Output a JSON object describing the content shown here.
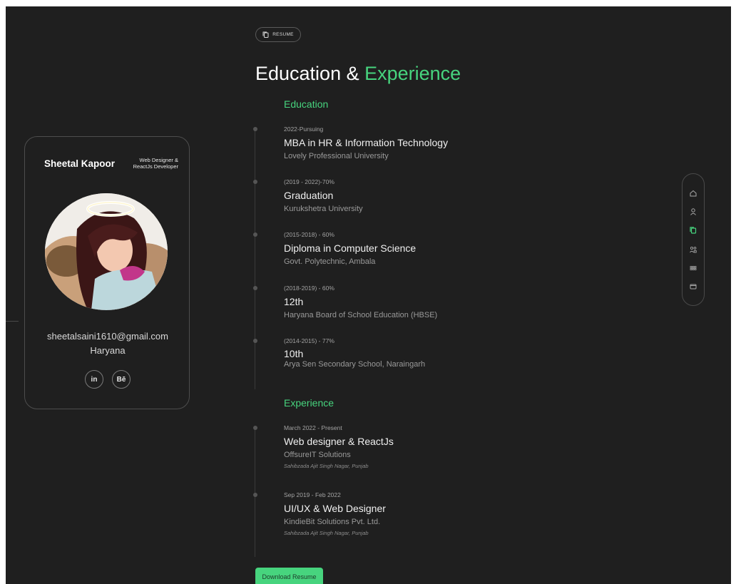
{
  "profile": {
    "name": "Sheetal Kapoor",
    "role_line1": "Web Designer &",
    "role_line2": "ReactJs Developer",
    "email": "sheetalsaini1610@gmail.com",
    "location": "Haryana",
    "social": [
      {
        "label": "in",
        "icon": "linkedin-icon"
      },
      {
        "label": "Bē",
        "icon": "behance-icon"
      }
    ]
  },
  "chip": {
    "label": "RESUME",
    "icon": "resume-icon"
  },
  "headline": {
    "part1": "Education & ",
    "accent": "Experience"
  },
  "education": {
    "title": "Education",
    "items": [
      {
        "period": "2022-Pursuing",
        "title": "MBA in HR & Information Technology",
        "place": "Lovely Professional University"
      },
      {
        "period": "(2019 - 2022)-70%",
        "title": "Graduation",
        "place": "Kurukshetra University"
      },
      {
        "period": "(2015-2018) - 60%",
        "title": "Diploma in Computer Science",
        "place": "Govt. Polytechnic, Ambala"
      },
      {
        "period": "(2018-2019) - 60%",
        "title": "12th",
        "place": "Haryana Board of School Education (HBSE)"
      },
      {
        "period": "(2014-2015) - 77%",
        "title": "10th",
        "place": "Arya Sen Secondary School, Naraingarh"
      }
    ]
  },
  "experience": {
    "title": "Experience",
    "items": [
      {
        "period": "March 2022 - Present",
        "title": "Web designer & ReactJs",
        "place": "OffsureIT Solutions",
        "location": "Sahibzada Ajit Singh Nagar, Punjab"
      },
      {
        "period": "Sep 2019 - Feb 2022",
        "title": "UI/UX & Web Designer",
        "place": "KindieBit Solutions Pvt. Ltd.",
        "location": "Sahibzada Ajit Singh Nagar, Punjab"
      }
    ]
  },
  "nav": {
    "items": [
      {
        "icon": "home-icon"
      },
      {
        "icon": "user-icon"
      },
      {
        "icon": "resume-icon",
        "active": true
      },
      {
        "icon": "services-icon"
      },
      {
        "icon": "portfolio-icon"
      },
      {
        "icon": "mail-icon"
      }
    ],
    "accent": "#47d47e"
  },
  "download": {
    "label": "Download Resume"
  },
  "colors": {
    "accent": "#47d47e",
    "background": "#1f1f1f"
  }
}
